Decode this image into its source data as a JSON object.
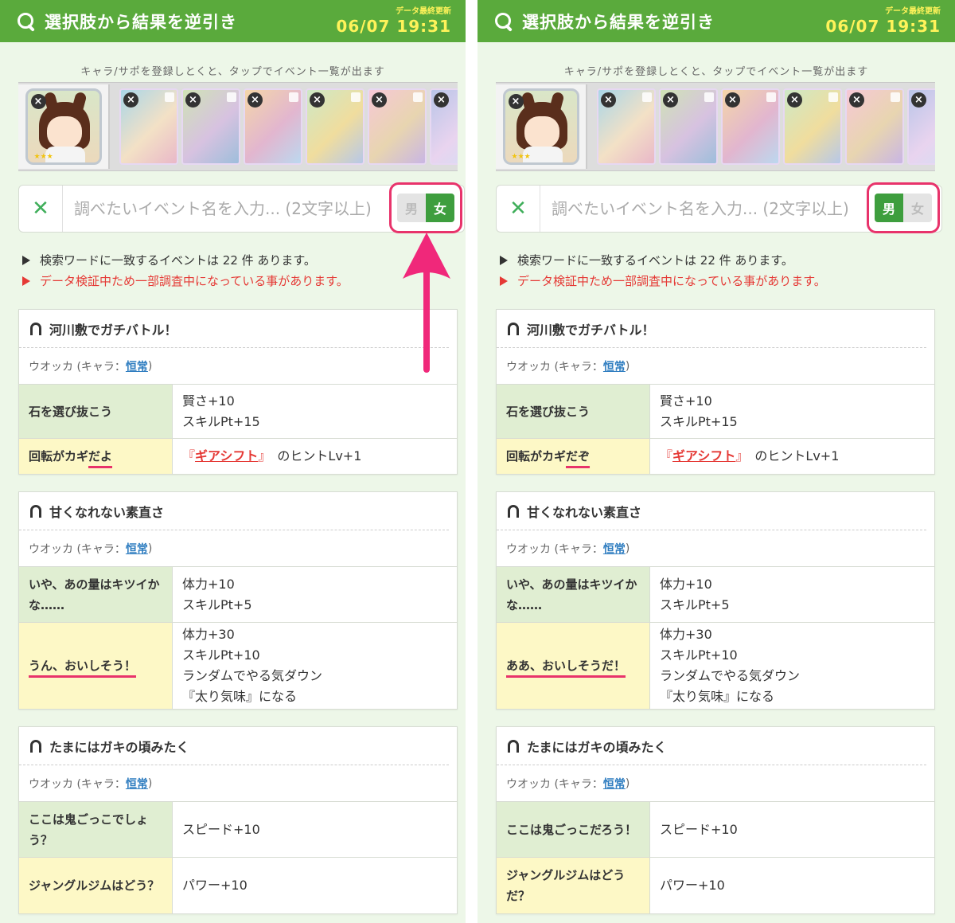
{
  "panels": [
    {
      "header": {
        "title": "選択肢から結果を逆引き",
        "update_label": "データ最終更新",
        "update_time": "06/07 19:31"
      },
      "hint": "キャラ/サポを登録しとくと、タップでイベント一覧が出ます",
      "search": {
        "placeholder": "調べたいイベント名を入力... (2文字以上)",
        "male": "男",
        "female": "女",
        "selected": "female"
      },
      "notes": {
        "count": "検索ワードに一致するイベントは 22 件 あります。",
        "warning": "データ検証中ため一部調査中になっている事があります。"
      },
      "events": [
        {
          "title": "河川敷でガチバトル！",
          "meta_pre": "ウオッカ (キャラ：",
          "tag": "恒常",
          "meta_post": ")",
          "rows": [
            {
              "choice_parts": [
                {
                  "t": "石を選び抜こう",
                  "u": false
                }
              ],
              "color": "g",
              "effects": [
                "賢さ+10",
                "スキルPt+15"
              ]
            },
            {
              "choice_parts": [
                {
                  "t": "回転がカギ",
                  "u": false
                },
                {
                  "t": "だよ",
                  "u": true
                }
              ],
              "color": "y",
              "skill": "ギアシフト",
              "skill_suffix": "のヒントLv+1"
            }
          ]
        },
        {
          "title": "甘くなれない素直さ",
          "meta_pre": "ウオッカ (キャラ：",
          "tag": "恒常",
          "meta_post": ")",
          "rows": [
            {
              "choice_parts": [
                {
                  "t": "いや、あの量はキツイかな……",
                  "u": false
                }
              ],
              "color": "g",
              "effects": [
                "体力+10",
                "スキルPt+5"
              ]
            },
            {
              "choice_parts": [
                {
                  "t": "うん、おいしそう！",
                  "u": true
                }
              ],
              "color": "y",
              "effects": [
                "体力+30",
                "スキルPt+10",
                "ランダムでやる気ダウン",
                "『太り気味』になる"
              ]
            }
          ]
        },
        {
          "title": "たまにはガキの頃みたく",
          "meta_pre": "ウオッカ (キャラ：",
          "tag": "恒常",
          "meta_post": ")",
          "rows": [
            {
              "choice_parts": [
                {
                  "t": "ここは鬼ごっこでしょう？",
                  "u": false
                }
              ],
              "color": "g",
              "effects": [
                "スピード+10"
              ]
            },
            {
              "choice_parts": [
                {
                  "t": "ジャングルジムはどう？",
                  "u": false
                }
              ],
              "color": "y",
              "effects": [
                "パワー+10"
              ]
            }
          ]
        }
      ]
    },
    {
      "header": {
        "title": "選択肢から結果を逆引き",
        "update_label": "データ最終更新",
        "update_time": "06/07 19:31"
      },
      "hint": "キャラ/サポを登録しとくと、タップでイベント一覧が出ます",
      "search": {
        "placeholder": "調べたいイベント名を入力... (2文字以上)",
        "male": "男",
        "female": "女",
        "selected": "male"
      },
      "notes": {
        "count": "検索ワードに一致するイベントは 22 件 あります。",
        "warning": "データ検証中ため一部調査中になっている事があります。"
      },
      "events": [
        {
          "title": "河川敷でガチバトル！",
          "meta_pre": "ウオッカ (キャラ：",
          "tag": "恒常",
          "meta_post": ")",
          "rows": [
            {
              "choice_parts": [
                {
                  "t": "石を選び抜こう",
                  "u": false
                }
              ],
              "color": "g",
              "effects": [
                "賢さ+10",
                "スキルPt+15"
              ]
            },
            {
              "choice_parts": [
                {
                  "t": "回転がカギ",
                  "u": false
                },
                {
                  "t": "だぞ",
                  "u": true
                }
              ],
              "color": "y",
              "skill": "ギアシフト",
              "skill_suffix": "のヒントLv+1"
            }
          ]
        },
        {
          "title": "甘くなれない素直さ",
          "meta_pre": "ウオッカ (キャラ：",
          "tag": "恒常",
          "meta_post": ")",
          "rows": [
            {
              "choice_parts": [
                {
                  "t": "いや、あの量はキツイかな……",
                  "u": false
                }
              ],
              "color": "g",
              "effects": [
                "体力+10",
                "スキルPt+5"
              ]
            },
            {
              "choice_parts": [
                {
                  "t": "ああ、おいしそうだ！",
                  "u": true
                }
              ],
              "color": "y",
              "effects": [
                "体力+30",
                "スキルPt+10",
                "ランダムでやる気ダウン",
                "『太り気味』になる"
              ]
            }
          ]
        },
        {
          "title": "たまにはガキの頃みたく",
          "meta_pre": "ウオッカ (キャラ：",
          "tag": "恒常",
          "meta_post": ")",
          "rows": [
            {
              "choice_parts": [
                {
                  "t": "ここは鬼ごっこだろう！",
                  "u": false
                }
              ],
              "color": "g",
              "effects": [
                "スピード+10"
              ]
            },
            {
              "choice_parts": [
                {
                  "t": "ジャングルジムはどうだ？",
                  "u": false
                }
              ],
              "color": "y",
              "effects": [
                "パワー+10"
              ]
            }
          ]
        }
      ]
    }
  ],
  "colors": {
    "header": "#5aaa3c",
    "accent_pink": "#e8336b",
    "toggle_on": "#3e9e3e",
    "warning": "#e53935",
    "tag_blue": "#2f7dc0"
  }
}
